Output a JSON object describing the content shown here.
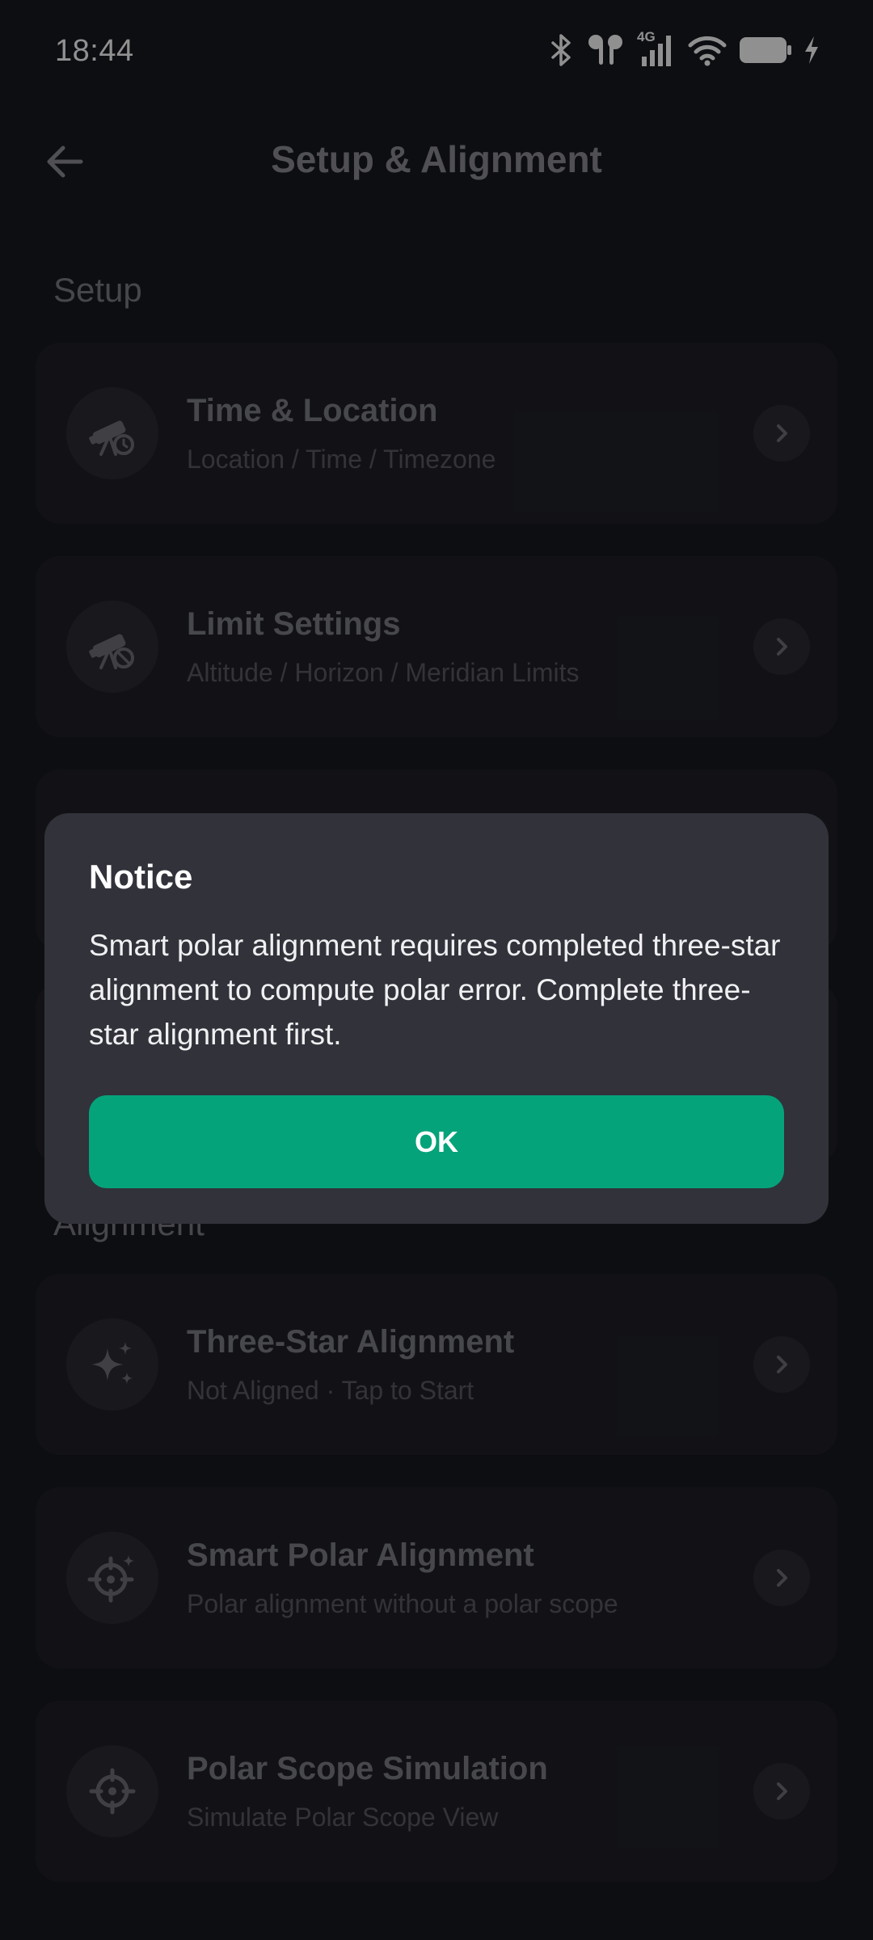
{
  "status_bar": {
    "time": "18:44",
    "network": "4G",
    "icons": [
      "bluetooth-icon",
      "earbuds-icon",
      "signal-icon",
      "wifi-icon",
      "battery-icon",
      "charging-icon"
    ]
  },
  "header": {
    "title": "Setup & Alignment",
    "back_icon": "back-arrow-icon"
  },
  "sections": {
    "setup": {
      "title": "Setup"
    },
    "alignment": {
      "title": "Alignment"
    }
  },
  "cards": [
    {
      "title": "Time & Location",
      "subtitle": "Location / Time / Timezone",
      "icon": "telescope-clock-icon"
    },
    {
      "title": "Limit Settings",
      "subtitle": "Altitude / Horizon / Meridian Limits",
      "icon": "telescope-block-icon"
    },
    {
      "title": "Three-Star Alignment",
      "subtitle": "Not Aligned · Tap to Start",
      "icon": "sparkle-stars-icon"
    },
    {
      "title": "Smart Polar Alignment",
      "subtitle": "Polar alignment without a polar scope",
      "icon": "crosshair-star-icon"
    },
    {
      "title": "Polar Scope Simulation",
      "subtitle": "Simulate Polar Scope View",
      "icon": "crosshair-icon"
    }
  ],
  "dialog": {
    "title": "Notice",
    "message": "Smart polar alignment requires completed three-star alignment to compute polar error. Complete three-star alignment first.",
    "ok_label": "OK"
  },
  "colors": {
    "background": "#121317",
    "card": "#1a1b20",
    "dialog": "#31323a",
    "accent": "#05a37a"
  }
}
